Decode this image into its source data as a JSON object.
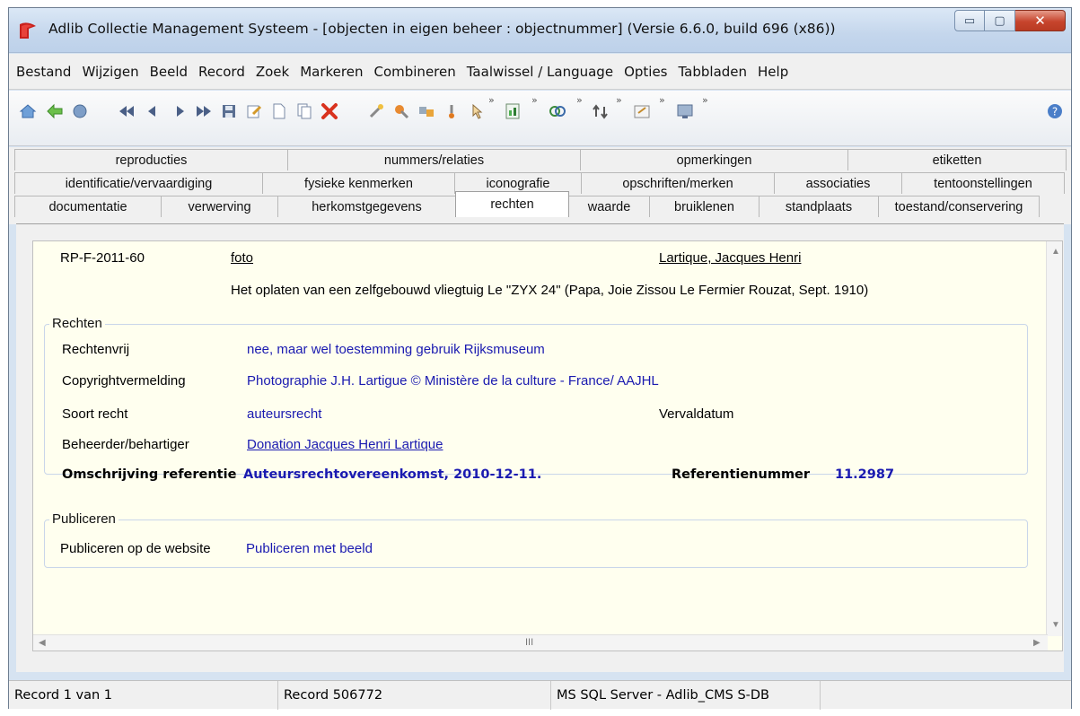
{
  "window": {
    "title": "Adlib Collectie Management Systeem - [objecten in eigen beheer  : objectnummer] (Versie 6.6.0, build 696 (x86))",
    "minimize_glyph": "▭",
    "maximize_glyph": "▢",
    "close_glyph": "✕"
  },
  "menu": [
    "Bestand",
    "Wijzigen",
    "Beeld",
    "Record",
    "Zoek",
    "Markeren",
    "Combineren",
    "Taalwissel / Language",
    "Opties",
    "Tabbladen",
    "Help"
  ],
  "toolbar": {
    "chevron": "»",
    "icons": [
      "home-icon",
      "back-icon",
      "forward-icon",
      "first-record-icon",
      "previous-record-icon",
      "next-record-icon",
      "last-record-icon",
      "save-icon",
      "edit-icon",
      "new-record-icon",
      "copy-record-icon",
      "delete-icon",
      "search-wand-icon",
      "bookmark-icon",
      "index-icon",
      "link-icon",
      "pointer-icon",
      "report-icon",
      "combine-icon",
      "sort-icon",
      "form-icon",
      "display-icon",
      "help-icon"
    ]
  },
  "tabs": {
    "row1": [
      "reproducties",
      "nummers/relaties",
      "opmerkingen",
      "etiketten"
    ],
    "row2": [
      "identificatie/vervaardiging",
      "fysieke kenmerken",
      "iconografie",
      "opschriften/merken",
      "associaties",
      "tentoonstellingen"
    ],
    "row3": [
      "documentatie",
      "verwerving",
      "herkomstgegevens",
      "rechten",
      "waarde",
      "bruiklenen",
      "standplaats",
      "toestand/conservering"
    ],
    "active": "rechten"
  },
  "record": {
    "object_number": "RP-F-2011-60",
    "object_name": "foto",
    "creator": "Lartique, Jacques Henri",
    "title": "Het oplaten van een zelfgebouwd vliegtuig Le \"ZYX 24\" (Papa, Joie Zissou Le Fermier Rouzat, Sept. 1910)"
  },
  "rechten": {
    "group_label": "Rechten",
    "rechtenvrij_label": "Rechtenvrij",
    "rechtenvrij_value": "nee, maar wel toestemming gebruik Rijksmuseum",
    "copyright_label": "Copyrightvermelding",
    "copyright_value": "Photographie J.H. Lartigue © Ministère de la culture - France/ AAJHL",
    "soort_label": "Soort recht",
    "soort_value": "auteursrecht",
    "vervaldatum_label": "Vervaldatum",
    "beheerder_label": "Beheerder/behartiger",
    "beheerder_value": "Donation Jacques Henri Lartique",
    "omschrijving_label": "Omschrijving referentie",
    "omschrijving_value": "Auteursrechtovereenkomst, 2010-12-11.",
    "referentienummer_label": "Referentienummer",
    "referentienummer_value": "11.2987"
  },
  "publiceren": {
    "group_label": "Publiceren",
    "label": "Publiceren op de website",
    "value": "Publiceren met beeld"
  },
  "scroll": {
    "thumb_glyph": "III"
  },
  "status": {
    "record_position": "Record 1 van 1",
    "record_id": "Record 506772",
    "database": "MS SQL Server - Adlib_CMS S-DB"
  }
}
